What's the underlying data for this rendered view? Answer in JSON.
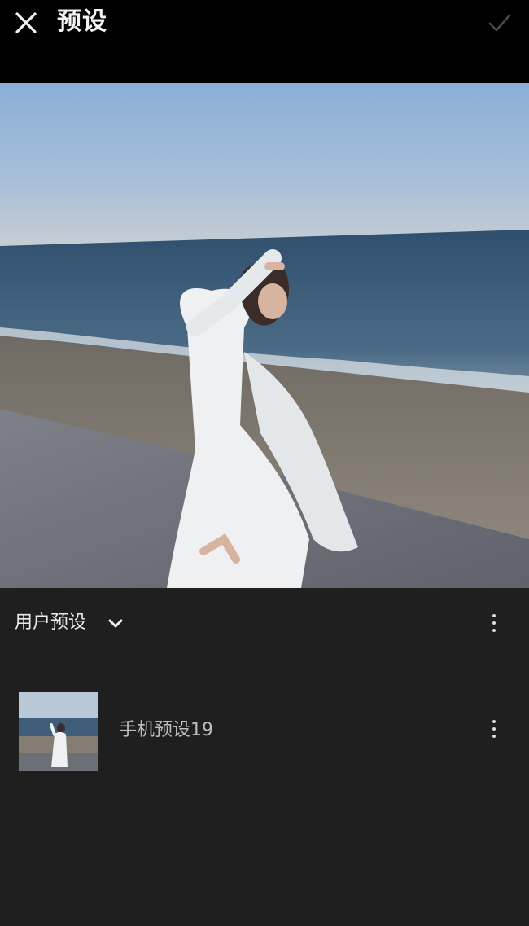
{
  "header": {
    "title": "预设",
    "close_icon": "close-icon",
    "confirm_icon": "check-icon"
  },
  "preset_group": {
    "label": "用户预设",
    "dropdown_icon": "chevron-down-icon",
    "more_icon": "more-vertical-icon"
  },
  "presets": [
    {
      "name": "手机预设19",
      "more_icon": "more-vertical-icon"
    }
  ],
  "colors": {
    "topbar_bg": "#000000",
    "panel_bg": "#1f1f1f",
    "text_primary": "#ececec",
    "text_secondary": "#bdbdbd",
    "divider": "#3a3a3a"
  }
}
